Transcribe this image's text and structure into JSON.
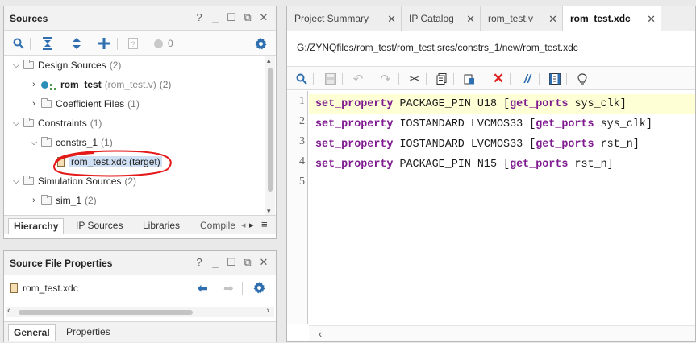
{
  "sources": {
    "title": "Sources",
    "toolbar": {
      "badge_count": "0"
    },
    "tree": [
      {
        "label": "Design Sources",
        "count": "(2)"
      },
      {
        "label": "rom_test",
        "sub": "(rom_test.v)",
        "count": "(2)"
      },
      {
        "label": "Coefficient Files",
        "count": "(1)"
      },
      {
        "label": "Constraints",
        "count": "(1)"
      },
      {
        "label": "constrs_1",
        "count": "(1)"
      },
      {
        "label": "rom_test.xdc (target)"
      },
      {
        "label": "Simulation Sources",
        "count": "(2)"
      },
      {
        "label": "sim_1",
        "count": "(2)"
      }
    ],
    "tabs": [
      "Hierarchy",
      "IP Sources",
      "Libraries",
      "Compile"
    ]
  },
  "properties": {
    "title": "Source File Properties",
    "file": "rom_test.xdc",
    "tabs": [
      "General",
      "Properties"
    ]
  },
  "editor": {
    "tabs": [
      {
        "label": "Project Summary"
      },
      {
        "label": "IP Catalog"
      },
      {
        "label": "rom_test.v"
      },
      {
        "label": "rom_test.xdc",
        "active": true
      }
    ],
    "path": "G:/ZYNQfiles/rom_test/rom_test.srcs/constrs_1/new/rom_test.xdc",
    "lines": [
      {
        "num": "1",
        "kw1": "set_property",
        "mid": " PACKAGE_PIN U18 ",
        "open": "[",
        "kw2": "get_ports",
        "arg": " sys_clk",
        "close": "]"
      },
      {
        "num": "2",
        "kw1": "set_property",
        "mid": " IOSTANDARD LVCMOS33 ",
        "open": "[",
        "kw2": "get_ports",
        "arg": " sys_clk",
        "close": "]"
      },
      {
        "num": "3",
        "kw1": "set_property",
        "mid": " IOSTANDARD LVCMOS33 ",
        "open": "[",
        "kw2": "get_ports",
        "arg": " rst_n",
        "close": "]"
      },
      {
        "num": "4",
        "kw1": "set_property",
        "mid": " PACKAGE_PIN N15 ",
        "open": "[",
        "kw2": "get_ports",
        "arg": " rst_n",
        "close": "]"
      },
      {
        "num": "5"
      }
    ]
  },
  "colors": {
    "keyword": "#7f1b8f",
    "highlight_line": "#ffffd6",
    "selection": "#cfe0f5",
    "annotation_circle": "#e41919",
    "accent_blue": "#2f6eaf"
  }
}
